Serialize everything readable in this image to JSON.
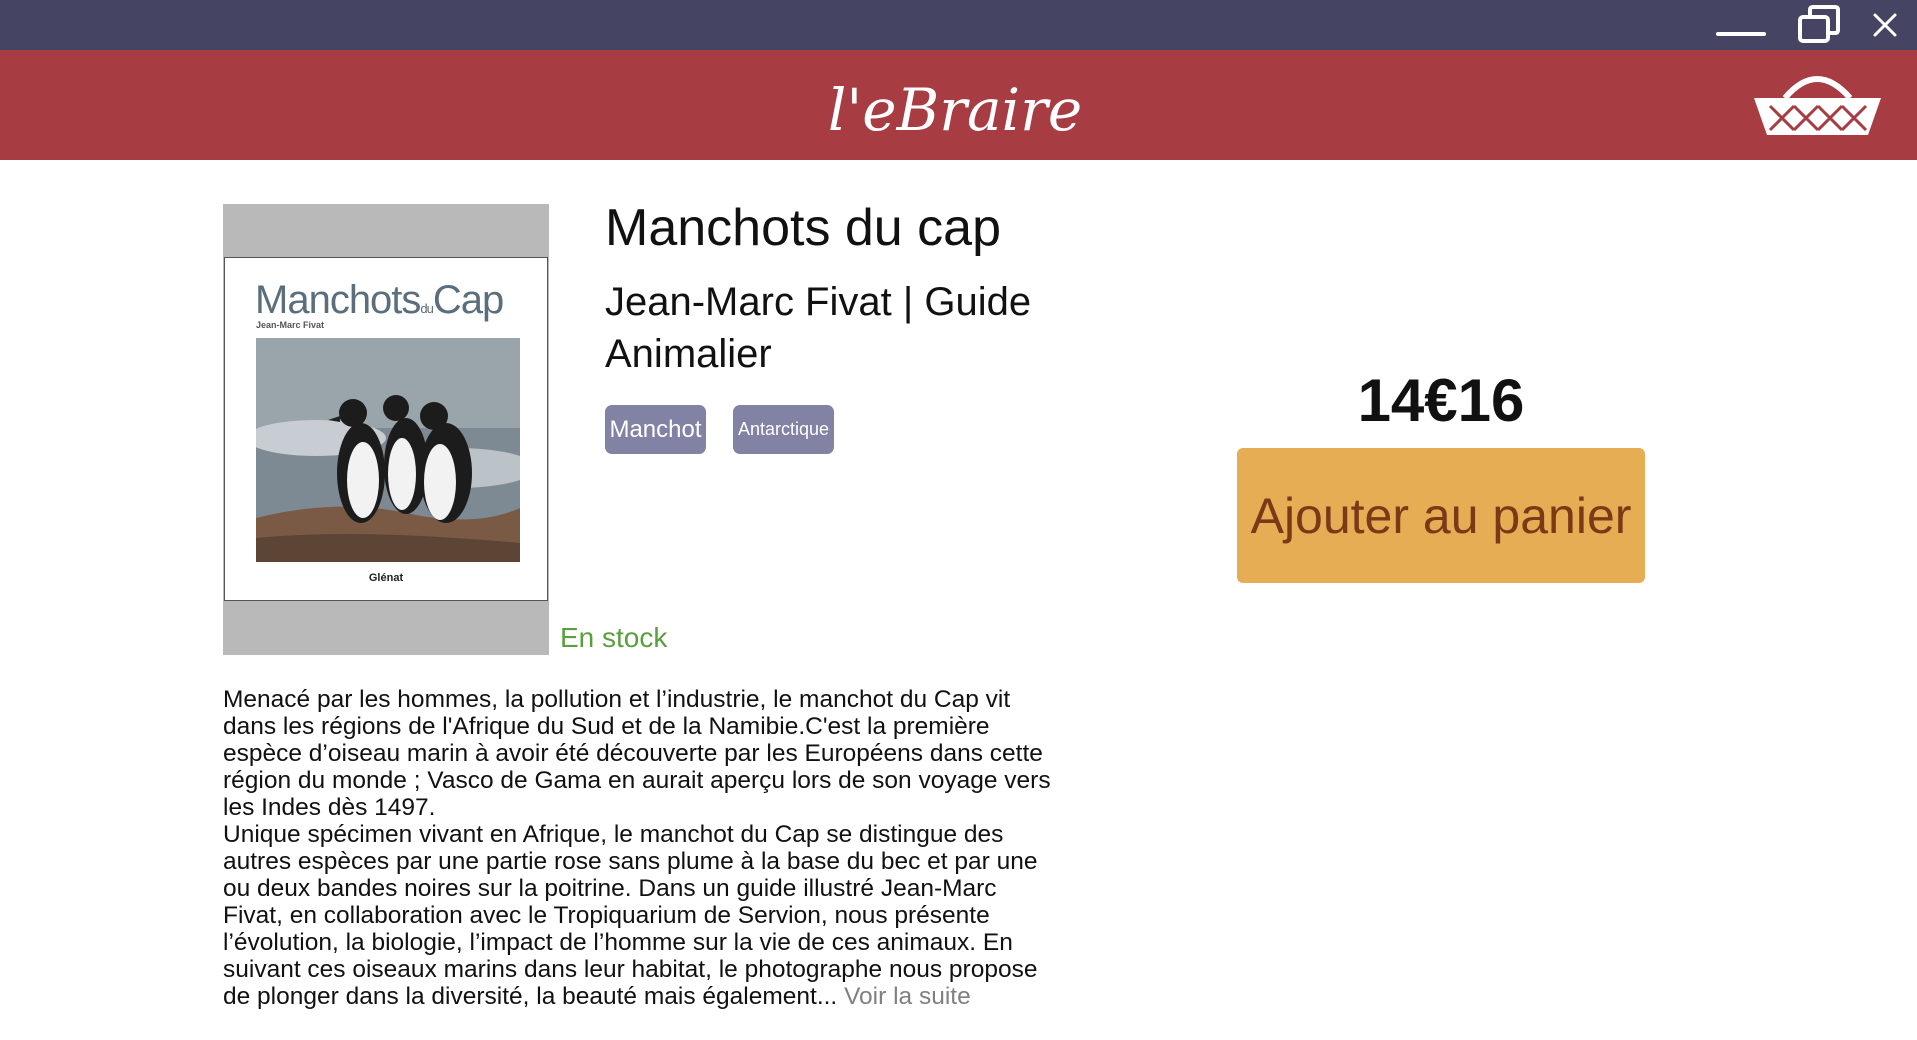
{
  "colors": {
    "titlebar": "#454563",
    "header": "#a73c42",
    "tag": "#8282a5",
    "stock": "#5a9e3d",
    "cart_button": "#e6ad55",
    "cart_button_text": "#7c3918"
  },
  "window_controls": {
    "minimize_icon": "minimize-icon",
    "restore_icon": "restore-icon",
    "close_icon": "close-icon"
  },
  "header": {
    "logo_text": "l'eBraire",
    "cart_icon": "basket-icon"
  },
  "cover": {
    "title": "Manchots",
    "title_small": "du",
    "title_end": "Cap",
    "author": "Jean-Marc Fivat",
    "publisher": "Glénat"
  },
  "book": {
    "title": "Manchots du cap",
    "subtitle": "Jean-Marc Fivat | Guide Animalier",
    "tags": [
      "Manchot",
      "Antarctique"
    ],
    "stock": "En stock",
    "price": "14€16",
    "add_to_cart": "Ajouter au panier",
    "description_p1": "Menacé par les hommes, la pollution et l’industrie, le manchot du Cap vit dans les régions de l'Afrique du Sud et de la Namibie.C'est la première espèce d’oiseau marin à avoir été découverte par les Européens dans cette région du monde ; Vasco de Gama en aurait aperçu lors de son voyage vers les Indes dès 1497.",
    "description_p2": "Unique spécimen vivant en Afrique, le manchot du Cap se distingue des autres espèces par une partie rose sans plume à la base du bec et par une ou deux bandes noires sur la poitrine. Dans un guide illustré Jean-Marc Fivat, en collaboration avec le Tropiquarium de Servion, nous présente l’évolution, la biologie, l’impact de l’homme sur la vie de ces animaux. En suivant ces oiseaux marins dans leur habitat, le photographe nous propose de plonger dans la diversité, la beauté mais également...",
    "read_more": "Voir la suite"
  }
}
